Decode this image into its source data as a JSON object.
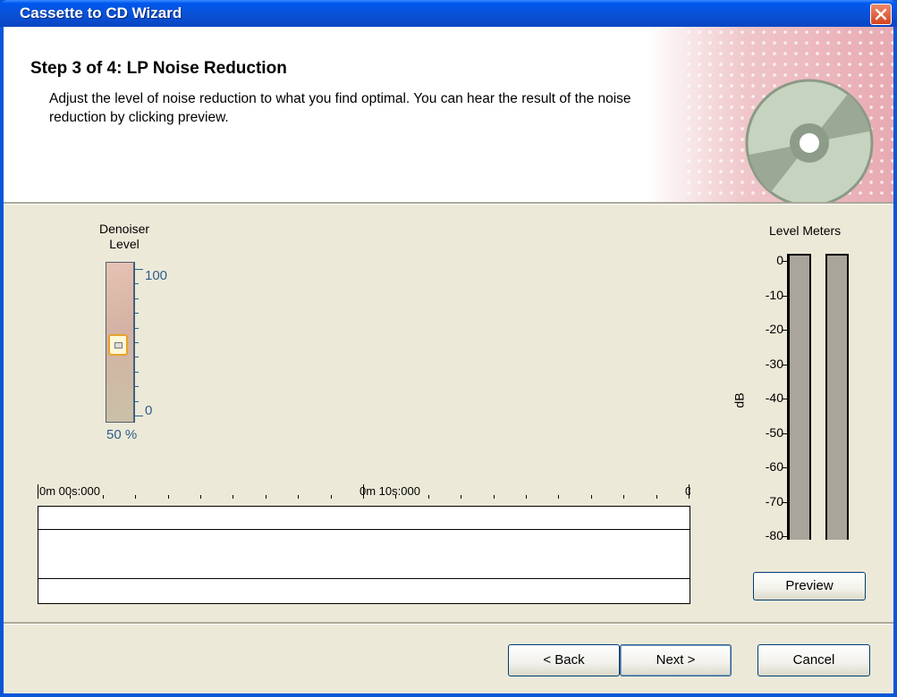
{
  "window": {
    "title": "Cassette to CD Wizard"
  },
  "header": {
    "step_title": "Step 3 of 4: LP Noise Reduction",
    "description": "Adjust the level of noise reduction to what you find optimal. You can hear the result of the noise reduction by clicking preview."
  },
  "denoiser": {
    "label_line1": "Denoiser",
    "label_line2": "Level",
    "scale_max": "100",
    "scale_min": "0",
    "value_text": "50 %",
    "value": 50
  },
  "timeline": {
    "marks": [
      "0m 00s:000",
      "0m 10s:000",
      "0"
    ]
  },
  "level_meters": {
    "title": "Level Meters",
    "unit": "dB",
    "scale": [
      "0",
      "-10",
      "-20",
      "-30",
      "-40",
      "-50",
      "-60",
      "-70",
      "-80"
    ]
  },
  "buttons": {
    "preview": "Preview",
    "back": "< Back",
    "next": "Next >",
    "cancel": "Cancel"
  },
  "colors": {
    "titlebar": "#0a50d6",
    "dialog_bg": "#ece9d8",
    "scale_blue": "#2f5e8e",
    "meter_fill": "#a9a59a"
  }
}
